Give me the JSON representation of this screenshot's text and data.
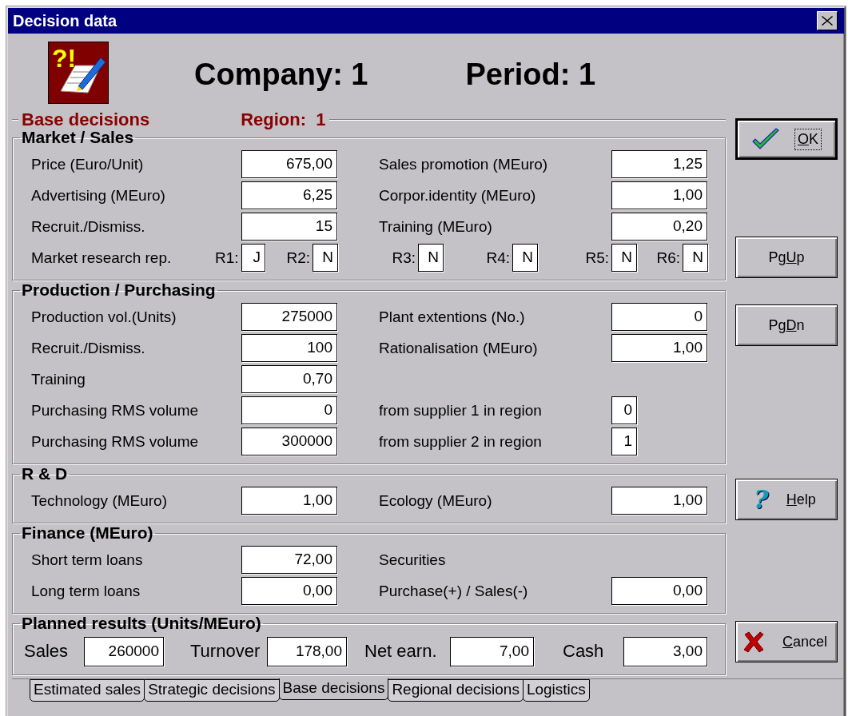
{
  "window": {
    "title": "Decision data"
  },
  "header": {
    "icon_marks": "?!",
    "company_label": "Company:",
    "company": "1",
    "period_label": "Period:",
    "period": "1"
  },
  "base": {
    "title": "Base decisions",
    "region_label": "Region:",
    "region": "1"
  },
  "groups": [
    {
      "title": "Market / Sales",
      "rows": [
        [
          {
            "kind": "field",
            "label": "Price (Euro/Unit)",
            "value": "675,00"
          },
          {
            "kind": "field",
            "label": "Sales promotion (MEuro)",
            "value": "1,25"
          }
        ],
        [
          {
            "kind": "field",
            "label": "Advertising (MEuro)",
            "value": "6,25"
          },
          {
            "kind": "field",
            "label": "Corpor.identity (MEuro)",
            "value": "1,00"
          }
        ],
        [
          {
            "kind": "field",
            "label": "Recruit./Dismiss.",
            "value": "15"
          },
          {
            "kind": "field",
            "label": "Training (MEuro)",
            "value": "0,20"
          }
        ]
      ],
      "research": {
        "label": "Market research rep.",
        "reports": [
          {
            "label": "R1:",
            "value": "J"
          },
          {
            "label": "R2:",
            "value": "N"
          },
          {
            "label": "R3:",
            "value": "N"
          },
          {
            "label": "R4:",
            "value": "N"
          },
          {
            "label": "R5:",
            "value": "N"
          },
          {
            "label": "R6:",
            "value": "N"
          }
        ]
      }
    },
    {
      "title": "Production / Purchasing",
      "rows": [
        [
          {
            "kind": "field",
            "label": "Production vol.(Units)",
            "value": "275000"
          },
          {
            "kind": "field",
            "label": "Plant extentions (No.)",
            "value": "0"
          }
        ],
        [
          {
            "kind": "field",
            "label": "Recruit./Dismiss.",
            "value": "100"
          },
          {
            "kind": "field",
            "label": "Rationalisation (MEuro)",
            "value": "1,00"
          }
        ],
        [
          {
            "kind": "field",
            "label": "Training",
            "value": "0,70"
          }
        ],
        [
          {
            "kind": "field",
            "label": "Purchasing RMS volume",
            "value": "0"
          },
          {
            "kind": "short",
            "label": "from supplier 1 in region",
            "value": "0"
          }
        ],
        [
          {
            "kind": "field",
            "label": "Purchasing RMS volume",
            "value": "300000"
          },
          {
            "kind": "short",
            "label": "from supplier 2 in region",
            "value": "1"
          }
        ]
      ]
    },
    {
      "title": "R & D",
      "rows": [
        [
          {
            "kind": "field",
            "label": "Technology (MEuro)",
            "value": "1,00"
          },
          {
            "kind": "field",
            "label": "Ecology (MEuro)",
            "value": "1,00"
          }
        ]
      ]
    },
    {
      "title": "Finance (MEuro)",
      "rows": [
        [
          {
            "kind": "field",
            "label": "Short term loans",
            "value": "72,00"
          },
          {
            "kind": "label",
            "label": "Securities"
          }
        ],
        [
          {
            "kind": "field",
            "label": "Long term loans",
            "value": "0,00"
          },
          {
            "kind": "field",
            "label": "Purchase(+) / Sales(-)",
            "value": "0,00"
          }
        ]
      ]
    }
  ],
  "planned": {
    "title": "Planned results (Units/MEuro)",
    "items": [
      {
        "label": "Sales",
        "value": "260000"
      },
      {
        "label": "Turnover",
        "value": "178,00"
      },
      {
        "label": "Net earn.",
        "value": "7,00"
      },
      {
        "label": "Cash",
        "value": "3,00"
      }
    ]
  },
  "buttons": [
    {
      "kind": "check",
      "label": [
        {
          "text": "O",
          "underlined": true
        },
        {
          "text": "K",
          "underlined": false
        }
      ],
      "default": true,
      "focused": true
    },
    {
      "kind": "plain",
      "label": [
        {
          "text": "Pg",
          "underlined": false
        },
        {
          "text": "U",
          "underlined": true
        },
        {
          "text": "p",
          "underlined": false
        }
      ],
      "default": false,
      "focused": false
    },
    {
      "kind": "plain",
      "label": [
        {
          "text": "Pg",
          "underlined": false
        },
        {
          "text": "D",
          "underlined": true
        },
        {
          "text": "n",
          "underlined": false
        }
      ],
      "default": false,
      "focused": false
    },
    {
      "kind": "help",
      "glyph": "?",
      "label": [
        {
          "text": "H",
          "underlined": true
        },
        {
          "text": "elp",
          "underlined": false
        }
      ],
      "default": false,
      "focused": false
    },
    {
      "kind": "cross",
      "label": [
        {
          "text": "C",
          "underlined": true
        },
        {
          "text": "ancel",
          "underlined": false
        }
      ],
      "default": false,
      "focused": false
    }
  ],
  "tabs": [
    {
      "label": "Estimated sales",
      "selected": false
    },
    {
      "label": "Strategic decisions",
      "selected": false
    },
    {
      "label": "Base decisions",
      "selected": true
    },
    {
      "label": "Regional decisions",
      "selected": false
    },
    {
      "label": "Logistics",
      "selected": false
    }
  ]
}
